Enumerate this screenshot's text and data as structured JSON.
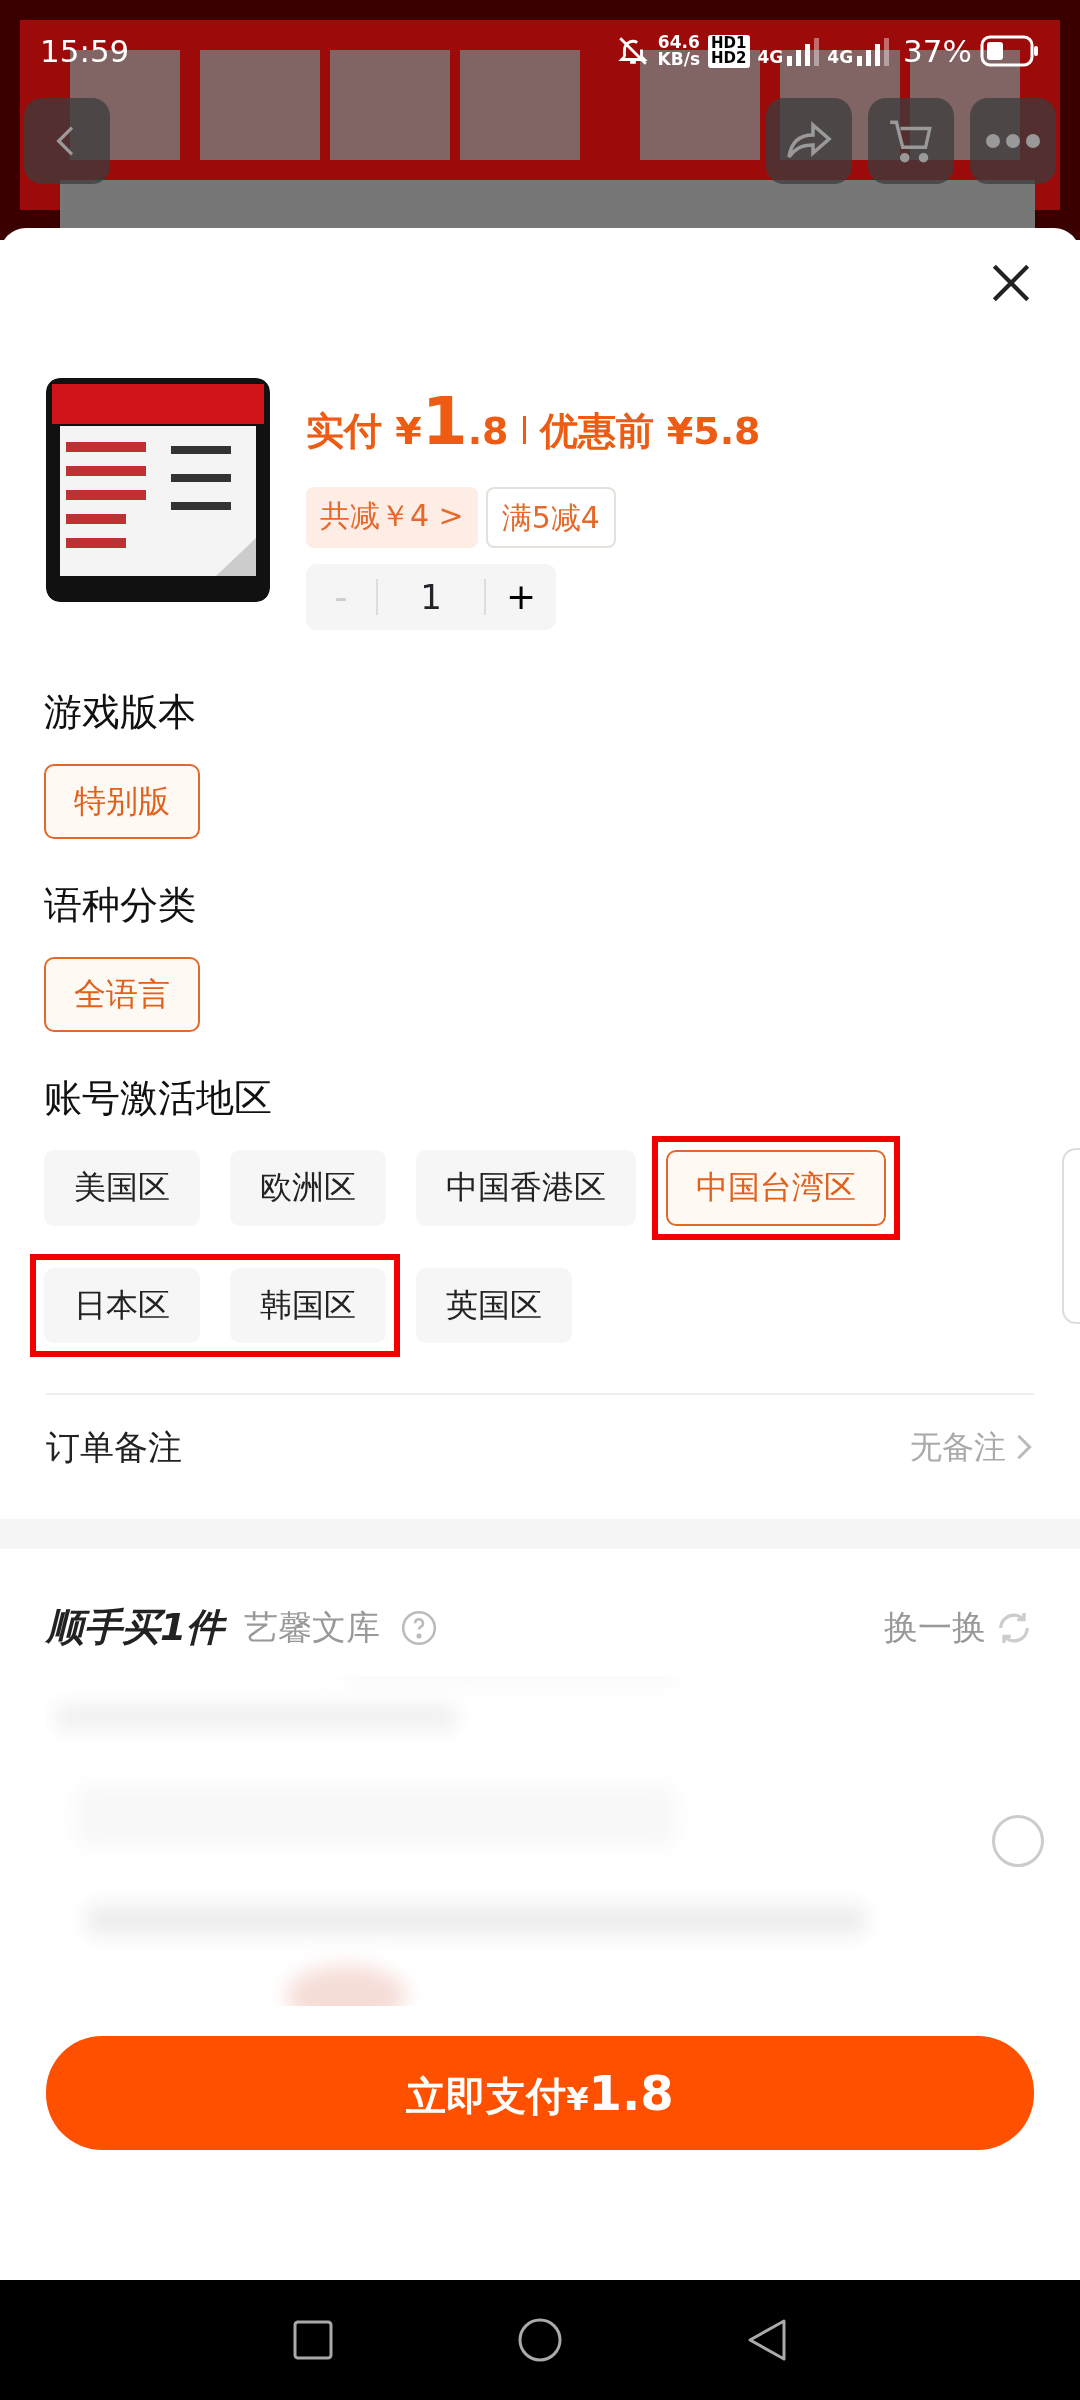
{
  "status_bar": {
    "time": "15:59",
    "net_speed": "64.6",
    "net_unit": "KB/s",
    "hd_top": "HD1",
    "hd_bottom": "HD2",
    "signal_1": "4G",
    "signal_2": "4G",
    "battery": "37%"
  },
  "product": {
    "paid_label": "实付",
    "paid_currency": "¥",
    "paid_whole": "1",
    "paid_fraction": ".8",
    "before_label": "优惠前",
    "before_price": "¥5.8",
    "discount": "共减￥4",
    "discount_arrow": ">",
    "promo": "满5减4",
    "minus": "-",
    "minus_disabled": true,
    "quantity": "1",
    "plus": "+"
  },
  "sections": [
    {
      "title": "游戏版本",
      "options": [
        {
          "kind": "chip",
          "label": "特别版",
          "selected": true
        }
      ]
    },
    {
      "title": "语种分类",
      "options": [
        {
          "kind": "chip",
          "label": "全语言",
          "selected": true
        }
      ]
    },
    {
      "title": "账号激活地区",
      "options": [
        {
          "kind": "chip",
          "label": "美国区",
          "selected": false
        },
        {
          "kind": "chip",
          "label": "欧洲区",
          "selected": false
        },
        {
          "kind": "chip",
          "label": "中国香港区",
          "selected": false
        },
        {
          "kind": "red_frame",
          "options": [
            {
              "kind": "chip",
              "label": "中国台湾区",
              "selected": true
            }
          ]
        },
        {
          "kind": "red_frame",
          "options": [
            {
              "kind": "chip",
              "label": "日本区",
              "selected": false
            },
            {
              "kind": "chip",
              "label": "韩国区",
              "selected": false
            }
          ]
        },
        {
          "kind": "chip",
          "label": "英国区",
          "selected": false
        }
      ]
    }
  ],
  "remark": {
    "label": "订单备注",
    "value": "无备注"
  },
  "addon": {
    "title": "顺手买1件",
    "shop": "艺馨文库",
    "refresh": "换一换",
    "selected": false
  },
  "pay_button": {
    "label": "立即支付",
    "currency": "¥",
    "amount": "1.8"
  }
}
